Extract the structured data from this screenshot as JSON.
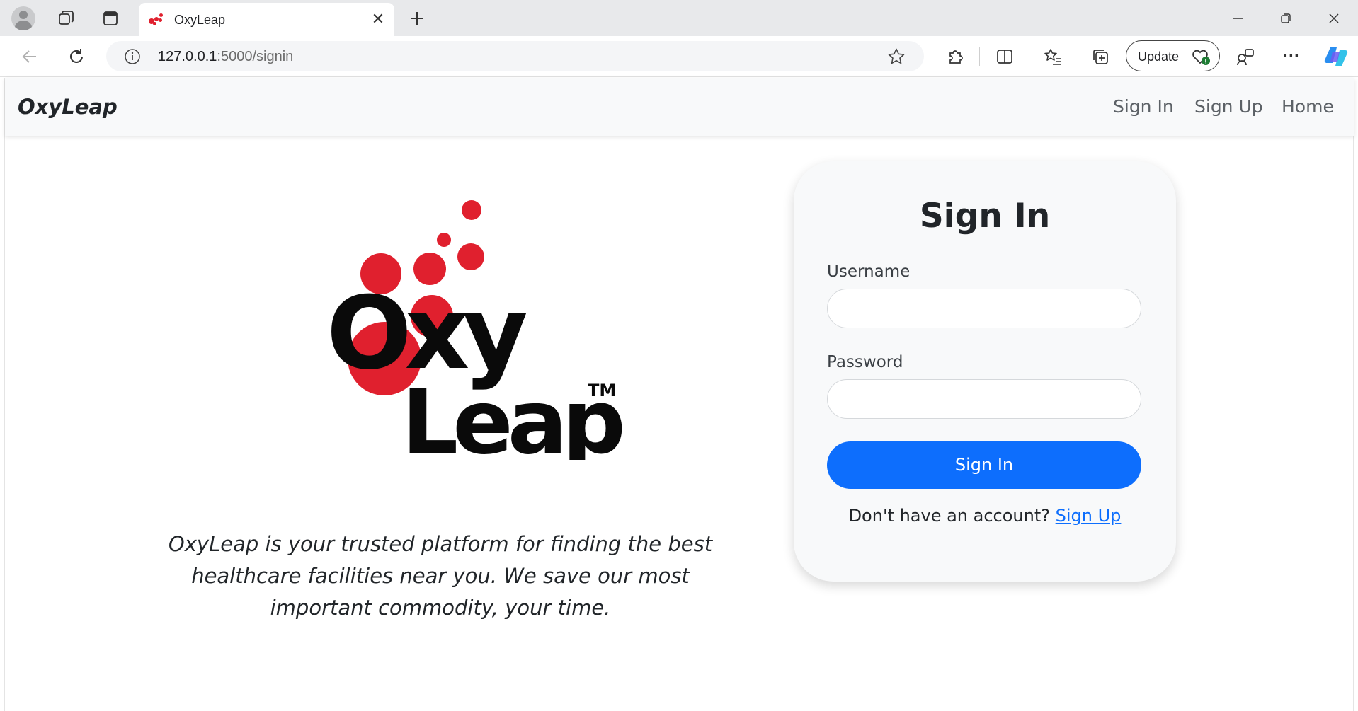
{
  "browser": {
    "tab": {
      "title": "OxyLeap"
    },
    "address": {
      "host": "127.0.0.1",
      "path": ":5000/signin"
    },
    "update_label": "Update"
  },
  "navbar": {
    "brand": "OxyLeap",
    "links": [
      "Sign In",
      "Sign Up",
      "Home"
    ]
  },
  "hero": {
    "logo": {
      "line1": "Oxy",
      "line2": "Leap",
      "tm": "TM"
    },
    "tagline": "OxyLeap is your trusted platform for finding the best healthcare facilities near you. We save our most important commodity, your time."
  },
  "signin_form": {
    "title": "Sign In",
    "username_label": "Username",
    "username_value": "",
    "password_label": "Password",
    "password_value": "",
    "submit_label": "Sign In",
    "footer_text": "Don't have an account?",
    "footer_link": "Sign Up"
  },
  "colors": {
    "primary": "#0d6efd",
    "brand_red": "#e0202e",
    "navbar_bg": "#f8f9fa",
    "card_bg": "#f8f9fa"
  }
}
